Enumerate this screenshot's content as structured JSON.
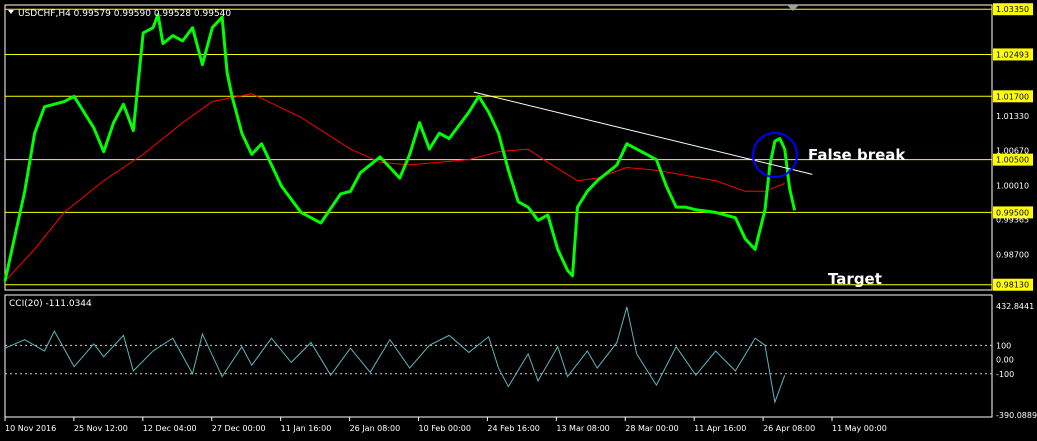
{
  "window": {
    "symbol_line": "USDCHF,H4  0.99579 0.99590 0.99528 0.99540",
    "cci_line": "CCI(20) -111.0344"
  },
  "annotations": {
    "false_break": "False break",
    "target": "Target"
  },
  "colors": {
    "background": "#000000",
    "price": "#00ff00",
    "ma": "#ff0000",
    "trendline": "#ffffff",
    "hlines": "#ffff00",
    "hline_label_bg": "#ffff00",
    "cci": "#5fb4be",
    "circle": "#0000ff",
    "grid_frame": "#ffffff",
    "axis_text": "#ffffff"
  },
  "chart_data": [
    {
      "type": "line",
      "title": "USDCHF,H4",
      "x_ticks": [
        "10 Nov 2016",
        "25 Nov 12:00",
        "12 Dec 04:00",
        "27 Dec 00:00",
        "11 Jan 16:00",
        "26 Jan 08:00",
        "10 Feb 00:00",
        "24 Feb 16:00",
        "13 Mar 08:00",
        "28 Mar 00:00",
        "11 Apr 16:00",
        "26 Apr 08:00",
        "11 May 00:00"
      ],
      "y_ticks": [
        "1.03350",
        "1.02493",
        "1.01700",
        "1.01330",
        "1.00670",
        "1.00500",
        "1.00010",
        "0.99500",
        "0.99365",
        "0.98700",
        "0.98130"
      ],
      "ylim": [
        0.9803,
        1.0343
      ],
      "series": [
        {
          "name": "USDCHF",
          "style": "close",
          "x": [
            0,
            0.02,
            0.03,
            0.04,
            0.06,
            0.07,
            0.09,
            0.1,
            0.11,
            0.12,
            0.13,
            0.14,
            0.15,
            0.155,
            0.16,
            0.17,
            0.18,
            0.19,
            0.2,
            0.21,
            0.22,
            0.225,
            0.23,
            0.24,
            0.25,
            0.26,
            0.27,
            0.28,
            0.3,
            0.32,
            0.34,
            0.35,
            0.36,
            0.38,
            0.4,
            0.41,
            0.42,
            0.43,
            0.44,
            0.45,
            0.47,
            0.48,
            0.49,
            0.5,
            0.51,
            0.52,
            0.53,
            0.54,
            0.55,
            0.56,
            0.57,
            0.575,
            0.58,
            0.59,
            0.6,
            0.62,
            0.63,
            0.64,
            0.65,
            0.66,
            0.67,
            0.68,
            0.69,
            0.7,
            0.72,
            0.74,
            0.75,
            0.76,
            0.77,
            0.775,
            0.78,
            0.785,
            0.79,
            0.795,
            0.8
          ],
          "y": [
            0.982,
            0.999,
            1.01,
            1.015,
            1.016,
            1.017,
            1.011,
            1.0065,
            1.012,
            1.0155,
            1.0105,
            1.029,
            1.03,
            1.0325,
            1.027,
            1.0285,
            1.0275,
            1.03,
            1.023,
            1.03,
            1.032,
            1.0215,
            1.017,
            1.01,
            1.006,
            1.008,
            1.004,
            1.0,
            0.995,
            0.993,
            0.9985,
            0.999,
            1.0025,
            1.0055,
            1.0015,
            1.006,
            1.012,
            1.007,
            1.01,
            1.009,
            1.014,
            1.017,
            1.014,
            1.01,
            1.003,
            0.997,
            0.996,
            0.9935,
            0.9945,
            0.988,
            0.984,
            0.983,
            0.996,
            0.999,
            1.001,
            1.004,
            1.008,
            1.007,
            1.006,
            1.005,
            1.0,
            0.996,
            0.996,
            0.9955,
            0.995,
            0.994,
            0.99,
            0.988,
            0.9955,
            1.004,
            1.0085,
            1.009,
            1.007,
            0.9995,
            0.9954
          ]
        },
        {
          "name": "MA",
          "style": "ma",
          "x": [
            0,
            0.03,
            0.06,
            0.1,
            0.14,
            0.18,
            0.21,
            0.25,
            0.3,
            0.35,
            0.38,
            0.41,
            0.44,
            0.47,
            0.5,
            0.53,
            0.55,
            0.58,
            0.6,
            0.63,
            0.66,
            0.69,
            0.72,
            0.75,
            0.77,
            0.79
          ],
          "y": [
            0.982,
            0.988,
            0.995,
            1.001,
            1.006,
            1.012,
            1.016,
            1.0175,
            1.013,
            1.007,
            1.0045,
            1.004,
            1.0045,
            1.005,
            1.0065,
            1.007,
            1.0045,
            1.001,
            1.0015,
            1.0035,
            1.003,
            1.002,
            1.001,
            0.999,
            0.999,
            1.0005
          ]
        }
      ],
      "horizontal_lines": [
        "1.03350",
        "1.02493",
        "1.01700",
        "1.00500",
        "0.99500",
        "0.98130"
      ],
      "current_price_label": "0.99500",
      "trendline": {
        "x": [
          0.475,
          0.818
        ],
        "y": [
          1.0178,
          1.0022
        ]
      }
    },
    {
      "type": "line",
      "title": "CCI(20) -111.0344",
      "y_ticks": [
        "432.8441",
        "100",
        "0.00",
        "-100",
        "-390.0889"
      ],
      "ylim": [
        -390.0889,
        432.8441
      ],
      "levels": [
        100,
        -100
      ],
      "series": [
        {
          "name": "CCI(20)",
          "x": [
            0,
            0.02,
            0.04,
            0.05,
            0.07,
            0.09,
            0.1,
            0.12,
            0.13,
            0.15,
            0.17,
            0.19,
            0.2,
            0.22,
            0.24,
            0.25,
            0.27,
            0.29,
            0.31,
            0.33,
            0.35,
            0.37,
            0.39,
            0.41,
            0.43,
            0.45,
            0.47,
            0.49,
            0.5,
            0.51,
            0.53,
            0.54,
            0.56,
            0.57,
            0.59,
            0.6,
            0.62,
            0.63,
            0.64,
            0.66,
            0.68,
            0.7,
            0.72,
            0.74,
            0.76,
            0.77,
            0.78,
            0.79
          ],
          "y": [
            80,
            140,
            60,
            200,
            -50,
            110,
            20,
            170,
            -80,
            60,
            150,
            -100,
            180,
            -120,
            90,
            -40,
            150,
            -20,
            120,
            -110,
            80,
            -90,
            140,
            -60,
            100,
            170,
            50,
            160,
            -60,
            -190,
            40,
            -150,
            90,
            -120,
            60,
            -60,
            120,
            370,
            40,
            -180,
            90,
            -110,
            60,
            -80,
            150,
            100,
            -300,
            -111
          ]
        }
      ]
    }
  ]
}
